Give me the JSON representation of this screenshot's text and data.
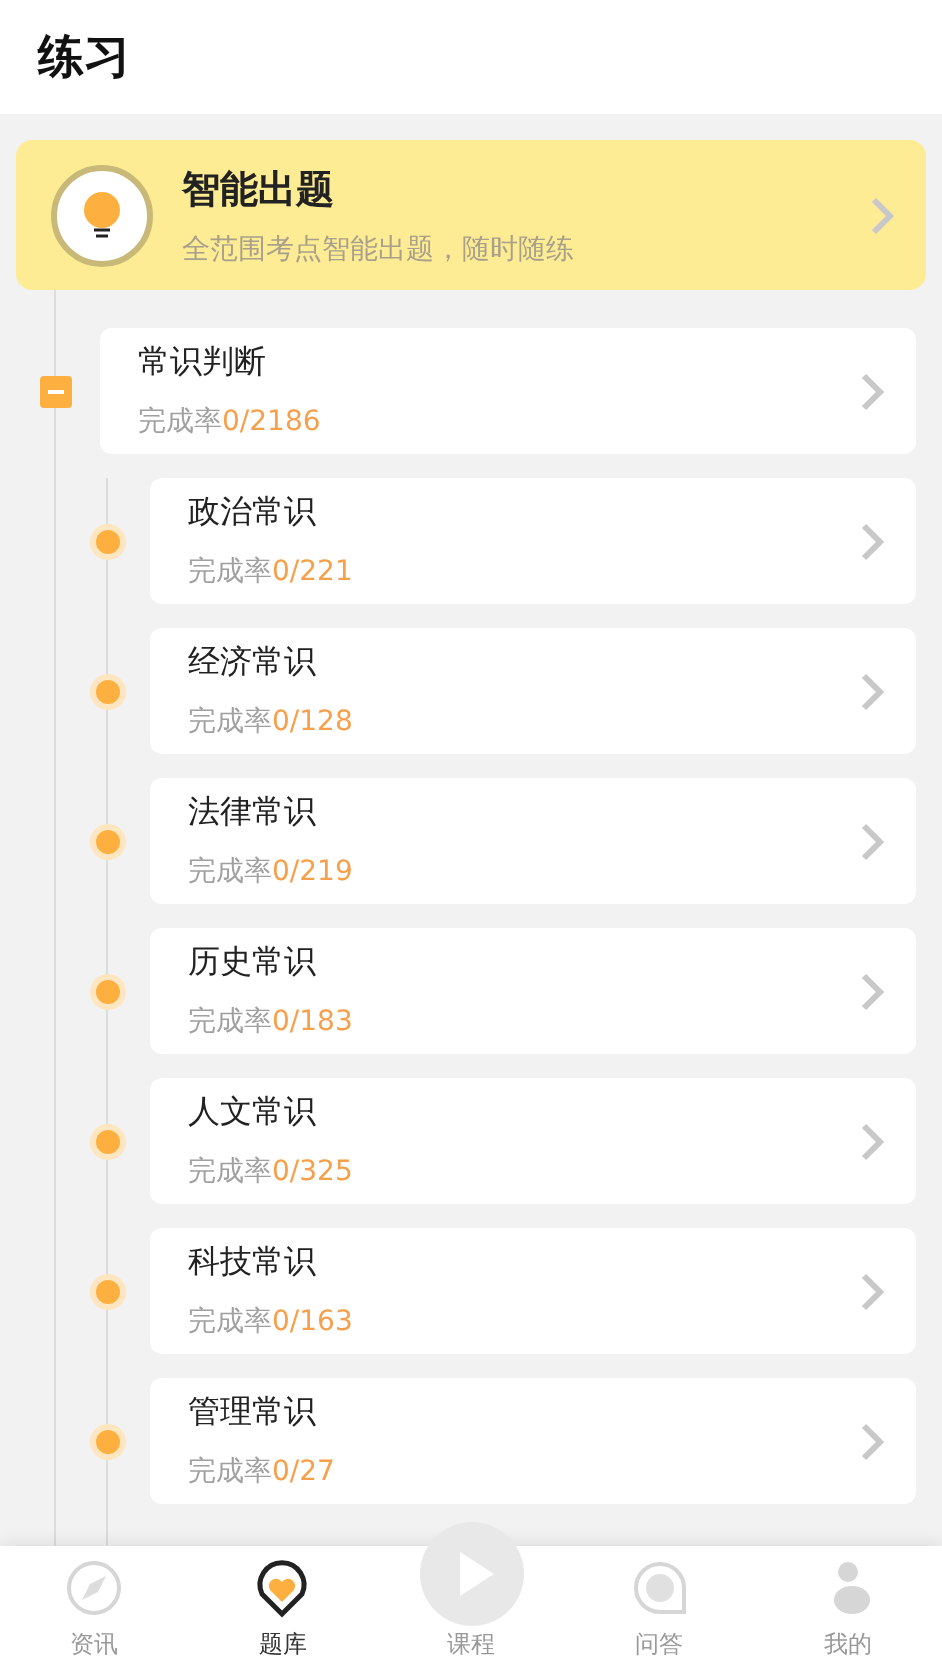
{
  "header": {
    "title": "练习"
  },
  "smart": {
    "title": "智能出题",
    "subtitle": "全范围考点智能出题，随时随练"
  },
  "category": {
    "name": "常识判断",
    "rate_label": "完成率",
    "rate": "0/2186",
    "expanded": true,
    "children": [
      {
        "name": "政治常识",
        "rate_label": "完成率",
        "rate": "0/221"
      },
      {
        "name": "经济常识",
        "rate_label": "完成率",
        "rate": "0/128"
      },
      {
        "name": "法律常识",
        "rate_label": "完成率",
        "rate": "0/219"
      },
      {
        "name": "历史常识",
        "rate_label": "完成率",
        "rate": "0/183"
      },
      {
        "name": "人文常识",
        "rate_label": "完成率",
        "rate": "0/325"
      },
      {
        "name": "科技常识",
        "rate_label": "完成率",
        "rate": "0/163"
      },
      {
        "name": "管理常识",
        "rate_label": "完成率",
        "rate": "0/27"
      }
    ]
  },
  "tabs": [
    {
      "label": "资讯",
      "kind": "compass",
      "selected": false
    },
    {
      "label": "题库",
      "kind": "heart",
      "selected": true
    },
    {
      "label": "课程",
      "kind": "play",
      "selected": false
    },
    {
      "label": "问答",
      "kind": "bubble",
      "selected": false
    },
    {
      "label": "我的",
      "kind": "person",
      "selected": false
    }
  ]
}
